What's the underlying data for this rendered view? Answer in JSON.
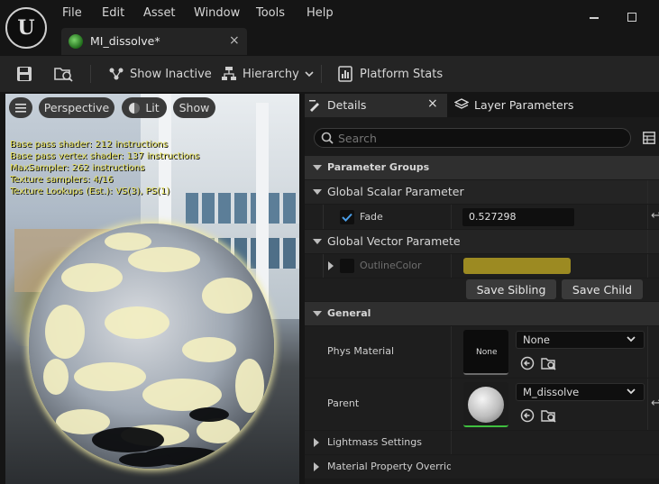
{
  "menu": [
    "File",
    "Edit",
    "Asset",
    "Window",
    "Tools",
    "Help"
  ],
  "document_tab": {
    "label": "MI_dissolve*",
    "close": "×"
  },
  "toolbar": {
    "show_inactive": "Show Inactive",
    "hierarchy": "Hierarchy",
    "platform_stats": "Platform Stats"
  },
  "viewport": {
    "perspective": "Perspective",
    "lit": "Lit",
    "show": "Show",
    "stats": [
      "Base pass shader: 212 instructions",
      "Base pass vertex shader: 137 instructions",
      "MaxSampler: 262 instructions",
      "Texture samplers: 4/16",
      "Texture Lookups (Est.): VS(3), PS(1)"
    ]
  },
  "details": {
    "tab_details": "Details",
    "tab_close": "×",
    "tab_layer": "Layer Parameters",
    "search_placeholder": "Search",
    "parameter_groups": "Parameter Groups",
    "global_scalar": "Global Scalar Parameter",
    "fade_label": "Fade",
    "fade_value": "0.527298",
    "fade_checked": true,
    "global_vector": "Global Vector Paramete",
    "outline_color_label": "OutlineColor",
    "outline_color": "#9c8a22",
    "save_sibling": "Save Sibling",
    "save_child": "Save Child",
    "general": "General",
    "phys_material": "Phys Material",
    "phys_thumb_label": "None",
    "phys_value": "None",
    "parent": "Parent",
    "parent_value": "M_dissolve",
    "lightmass": "Lightmass Settings",
    "material_overrides": "Material Property Overrides"
  },
  "colors": {
    "background": "#151515",
    "panel": "#1a1a1a",
    "stats_text": "#e6e05a",
    "accent_check": "#4a9ee8"
  },
  "icons": [
    "unreal-logo-icon",
    "save-icon",
    "browse-icon",
    "show-inactive-icon",
    "hierarchy-icon",
    "platform-stats-icon",
    "menu-icon",
    "lit-icon",
    "details-icon",
    "layers-icon",
    "search-icon",
    "table-view-icon",
    "reset-arrow-icon",
    "use-selected-icon",
    "browse-asset-icon",
    "chevron-down-icon"
  ]
}
